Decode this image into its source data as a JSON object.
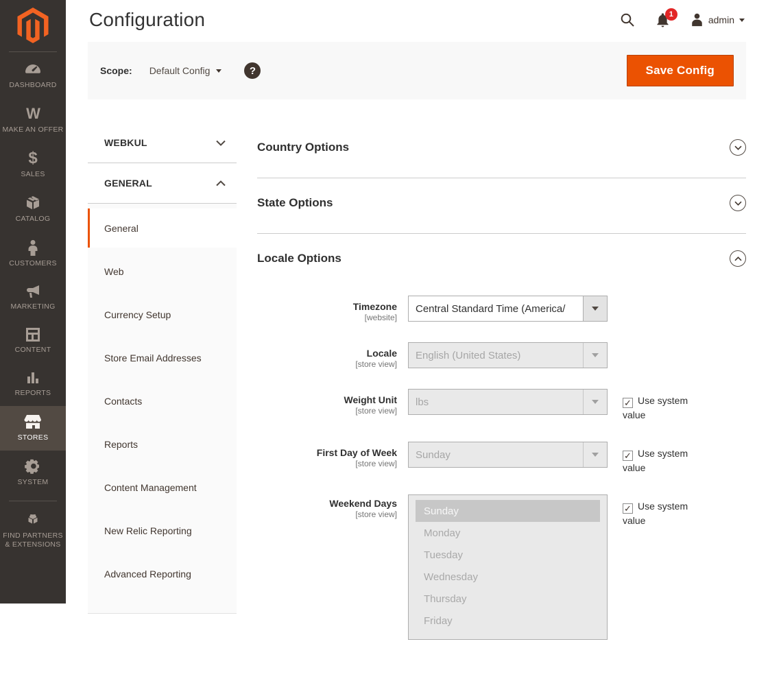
{
  "colors": {
    "accent": "#eb5202",
    "sidebar_bg": "#373330",
    "sidebar_active_bg": "#524a43",
    "badge_red": "#e22626",
    "save_button_bg": "#eb5202",
    "disabled_field_bg": "#e9e9e9"
  },
  "header": {
    "title": "Configuration",
    "user_name": "admin",
    "notification_count": "1"
  },
  "scope_bar": {
    "label": "Scope:",
    "value": "Default Config",
    "help_glyph": "?",
    "save_button": "Save Config"
  },
  "sidebar": {
    "items": [
      {
        "label": "DASHBOARD",
        "icon": "dashboard-icon"
      },
      {
        "label": "MAKE AN OFFER",
        "icon": "make-an-offer-icon"
      },
      {
        "label": "SALES",
        "icon": "sales-icon",
        "glyph": "$"
      },
      {
        "label": "CATALOG",
        "icon": "catalog-icon"
      },
      {
        "label": "CUSTOMERS",
        "icon": "customers-icon"
      },
      {
        "label": "MARKETING",
        "icon": "marketing-icon"
      },
      {
        "label": "CONTENT",
        "icon": "content-icon"
      },
      {
        "label": "REPORTS",
        "icon": "reports-icon"
      },
      {
        "label": "STORES",
        "icon": "stores-icon",
        "active": true
      },
      {
        "label": "SYSTEM",
        "icon": "system-icon"
      },
      {
        "label": "FIND PARTNERS & EXTENSIONS",
        "icon": "extensions-icon"
      }
    ],
    "make_offer_glyph": "W"
  },
  "config_nav": {
    "sections": [
      {
        "label": "WEBKUL",
        "state": "collapsed"
      },
      {
        "label": "GENERAL",
        "state": "expanded"
      }
    ],
    "items": [
      {
        "label": "General",
        "active": true
      },
      {
        "label": "Web"
      },
      {
        "label": "Currency Setup"
      },
      {
        "label": "Store Email Addresses"
      },
      {
        "label": "Contacts"
      },
      {
        "label": "Reports"
      },
      {
        "label": "Content Management"
      },
      {
        "label": "New Relic Reporting"
      },
      {
        "label": "Advanced Reporting"
      }
    ]
  },
  "content": {
    "sections": [
      {
        "title": "Country Options",
        "state": "collapsed"
      },
      {
        "title": "State Options",
        "state": "collapsed"
      },
      {
        "title": "Locale Options",
        "state": "expanded"
      }
    ],
    "use_system_value_label": "Use system value",
    "fields": [
      {
        "label": "Timezone",
        "scope": "[website]",
        "type": "select",
        "value": "Central Standard Time (America/",
        "disabled": false,
        "use_system_value": false
      },
      {
        "label": "Locale",
        "scope": "[store view]",
        "type": "select",
        "value": "English (United States)",
        "disabled": true,
        "use_system_value": false
      },
      {
        "label": "Weight Unit",
        "scope": "[store view]",
        "type": "select",
        "value": "lbs",
        "disabled": true,
        "use_system_value": true
      },
      {
        "label": "First Day of Week",
        "scope": "[store view]",
        "type": "select",
        "value": "Sunday",
        "disabled": true,
        "use_system_value": true
      },
      {
        "label": "Weekend Days",
        "scope": "[store view]",
        "type": "multiselect",
        "options": [
          "Sunday",
          "Monday",
          "Tuesday",
          "Wednesday",
          "Thursday",
          "Friday"
        ],
        "selected_option": "Sunday",
        "disabled": true,
        "use_system_value": true
      }
    ]
  }
}
